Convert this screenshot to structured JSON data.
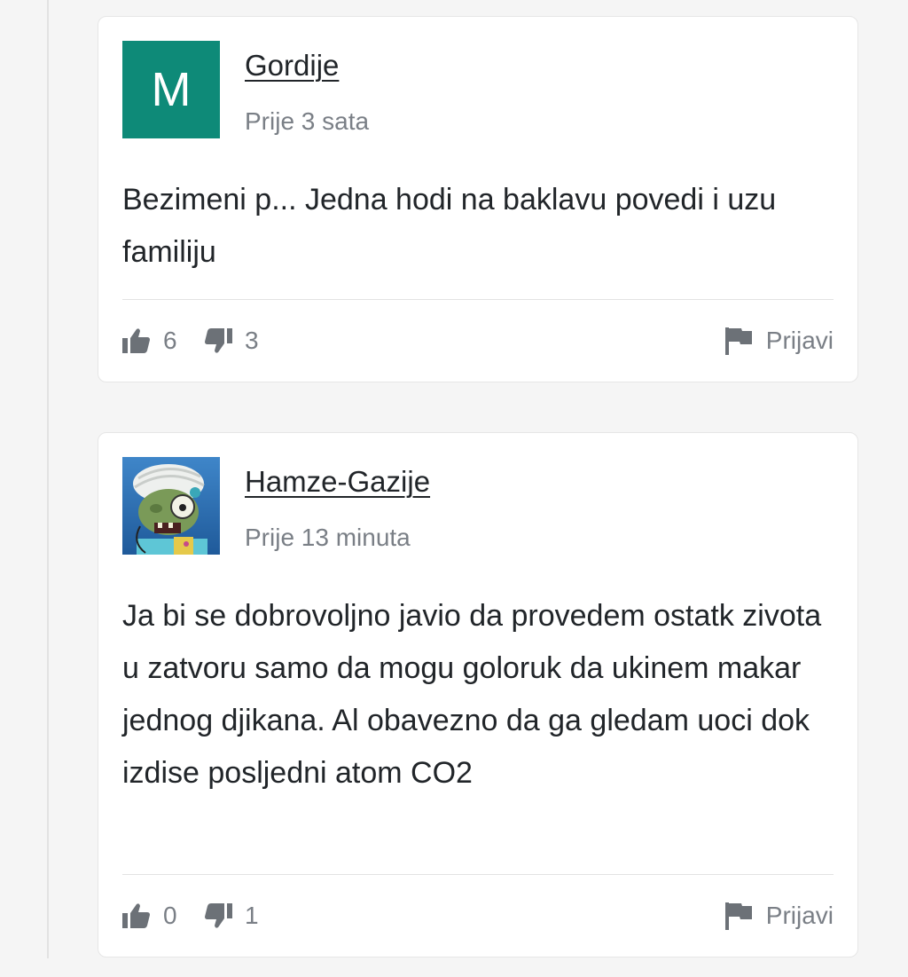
{
  "comments": [
    {
      "avatar_letter": "M",
      "avatar_color": "#0e8a78",
      "username": "Gordije",
      "time": "Prije 3 sata",
      "text": "Bezimeni p... Jedna hodi na baklavu povedi i uzu familiju",
      "likes": "6",
      "dislikes": "3",
      "report_label": "Prijavi"
    },
    {
      "avatar_icon": "zombie-avatar-icon",
      "username": "Hamze-Gazije",
      "time": "Prije 13 minuta",
      "text": "Ja bi se dobrovoljno javio da provedem ostatk zivota u zatvoru samo da mogu goloruk da ukinem makar jednog djikana. Al obavezno da ga gledam uoci dok izdise posljedni atom CO2",
      "likes": "0",
      "dislikes": "1",
      "report_label": "Prijavi"
    }
  ],
  "colors": {
    "page_bg": "#f5f5f5",
    "text": "#212529",
    "muted": "#7a7f86",
    "icon": "#6c7177"
  }
}
